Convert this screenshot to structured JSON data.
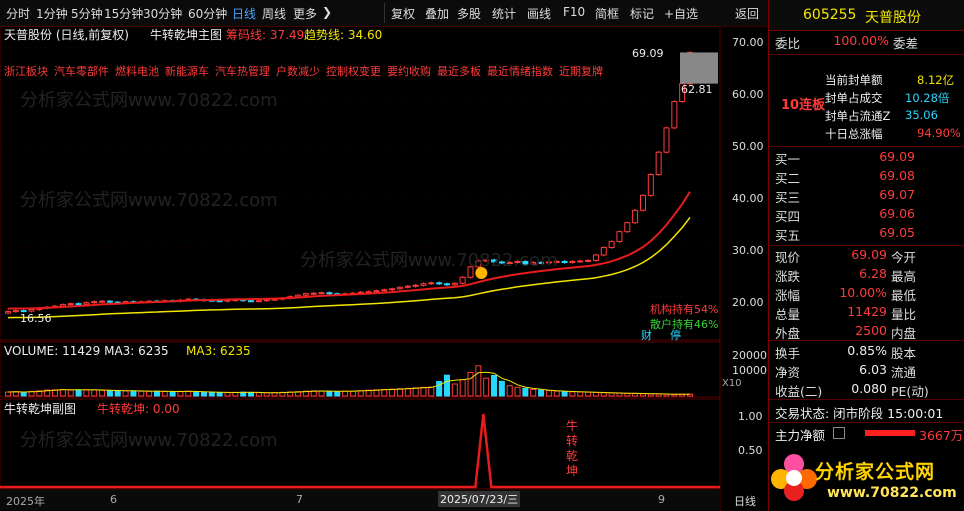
{
  "toolbar": {
    "items": [
      "分时",
      "1分钟",
      "5分钟",
      "15分钟",
      "30分钟",
      "60分钟",
      "日线",
      "周线",
      "更多",
      "复权",
      "叠加",
      "多股",
      "统计",
      "画线",
      "F10",
      "简框",
      "标记",
      "+自选",
      "返回"
    ],
    "active": "日线",
    "more_arrow": "❯"
  },
  "main_chart": {
    "title": "天普股份 (日线,前复权)",
    "indicator_name": "牛转乾坤主图",
    "chip_label": "筹码线: 37.49",
    "trend_label": "趋势线: 34.60",
    "concepts": [
      "浙江板块",
      "汽车零部件",
      "燃料电池",
      "新能源车",
      "汽车热管理",
      "户数减少",
      "控制权变更",
      "要约收购",
      "最近多板",
      "最近情绪指数",
      "近期复牌"
    ],
    "price_high_label": "69.09",
    "price_mark_label": "62.81",
    "low_label": "16.56",
    "inst_label": "机构持有54%",
    "retail_label": "散户持有46%",
    "cai_label": "财",
    "ting_label": "停",
    "y_axis": [
      "70.00",
      "60.00",
      "50.00",
      "40.00",
      "30.00",
      "20.00"
    ],
    "watermark": "分析家公式网www.70822.com"
  },
  "volume_chart": {
    "title": "VOLUME: 11429  MA3: 6235",
    "ma3_label": "MA3: 6235",
    "y_axis": [
      "20000",
      "10000"
    ],
    "unit": "X10"
  },
  "sub_chart": {
    "title": "牛转乾坤副图",
    "value_label": "牛转乾坤: 0.00",
    "signal_chars": [
      "牛",
      "转",
      "乾",
      "坤"
    ],
    "y_axis": [
      "1.00",
      "0.50"
    ]
  },
  "x_axis": {
    "labels": [
      "2025年",
      "6",
      "7",
      "2025/07/23/三",
      "9"
    ],
    "period_button": "日线"
  },
  "right_panel": {
    "code": "605255",
    "name": "天普股份",
    "weibi_label": "委比",
    "weibi_value": "100.00%",
    "weicha_label": "委差",
    "board_count": "10连板",
    "stats": [
      {
        "label": "当前封单额",
        "value": "8.12亿"
      },
      {
        "label": "封单占成交",
        "value": "10.28倍"
      },
      {
        "label": "封单占流通Z",
        "value": "35.06"
      },
      {
        "label": "十日总涨幅",
        "value": "94.90%"
      }
    ],
    "bids": [
      {
        "label": "买一",
        "price": "69.09"
      },
      {
        "label": "买二",
        "price": "69.08"
      },
      {
        "label": "买三",
        "price": "69.07"
      },
      {
        "label": "买四",
        "price": "69.06"
      },
      {
        "label": "买五",
        "price": "69.05"
      }
    ],
    "quote": [
      {
        "label": "现价",
        "value": "69.09",
        "label2": "今开"
      },
      {
        "label": "涨跌",
        "value": "6.28",
        "label2": "最高"
      },
      {
        "label": "涨幅",
        "value": "10.00%",
        "label2": "最低"
      },
      {
        "label": "总量",
        "value": "11429",
        "label2": "量比"
      },
      {
        "label": "外盘",
        "value": "2500",
        "label2": "内盘"
      }
    ],
    "quote2": [
      {
        "label": "换手",
        "value": "0.85%",
        "label2": "股本"
      },
      {
        "label": "净资",
        "value": "6.03",
        "label2": "流通"
      },
      {
        "label": "收益(二)",
        "value": "0.080",
        "label2": "PE(动)"
      }
    ],
    "trade_status_label": "交易状态: 闭市阶段 15:00:01",
    "main_flow_label": "主力净额",
    "main_flow_value": "3667万",
    "logo_text": "分析家公式网",
    "logo_url": "www.70822.com"
  },
  "chart_data": {
    "type": "candlestick",
    "closes": [
      16.9,
      17.1,
      17.0,
      17.3,
      17.6,
      17.8,
      18.0,
      18.3,
      18.5,
      18.4,
      18.7,
      18.9,
      19.0,
      18.8,
      18.7,
      18.9,
      18.8,
      18.9,
      19.0,
      18.9,
      19.1,
      19.0,
      19.2,
      19.4,
      19.3,
      19.2,
      19.1,
      19.0,
      19.2,
      19.3,
      19.1,
      19.0,
      19.1,
      19.3,
      19.4,
      19.6,
      19.9,
      20.2,
      20.5,
      20.6,
      20.7,
      20.5,
      20.4,
      20.5,
      20.6,
      20.8,
      20.9,
      21.1,
      21.3,
      21.5,
      21.8,
      22.0,
      22.2,
      22.5,
      22.7,
      22.5,
      22.3,
      22.6,
      23.8,
      25.9,
      27.1,
      27.3,
      26.9,
      26.7,
      26.8,
      27.0,
      26.5,
      26.8,
      26.7,
      26.9,
      27.0,
      26.8,
      27.0,
      27.1,
      27.2,
      28.3,
      29.8,
      31.0,
      33.0,
      34.8,
      37.3,
      40.3,
      44.5,
      49.0,
      53.9,
      59.2,
      62.8,
      69.09
    ],
    "volumes": [
      2400,
      2600,
      2200,
      2800,
      3100,
      3600,
      3700,
      3900,
      3500,
      3700,
      3800,
      3600,
      3400,
      3200,
      3300,
      3000,
      3100,
      2900,
      2800,
      2900,
      2700,
      2600,
      2800,
      2900,
      2500,
      2400,
      2300,
      2100,
      2000,
      2200,
      2300,
      2100,
      2000,
      1900,
      2000,
      2200,
      2400,
      2600,
      2900,
      3100,
      3000,
      2800,
      2700,
      2900,
      3000,
      3200,
      3500,
      3700,
      3900,
      4100,
      4400,
      4600,
      4900,
      5200,
      5400,
      8700,
      12500,
      7200,
      9800,
      14100,
      18100,
      10700,
      12300,
      8800,
      6200,
      5200,
      4600,
      3900,
      3500,
      3200,
      2900,
      2700,
      2500,
      2400,
      2300,
      2100,
      1900,
      1800,
      1700,
      1600,
      1500,
      1400,
      1300,
      1200,
      1100,
      1000,
      1143,
      1143
    ],
    "ylim": [
      14,
      72
    ],
    "volume_ylim": [
      0,
      24000
    ],
    "signal_index": 60
  }
}
